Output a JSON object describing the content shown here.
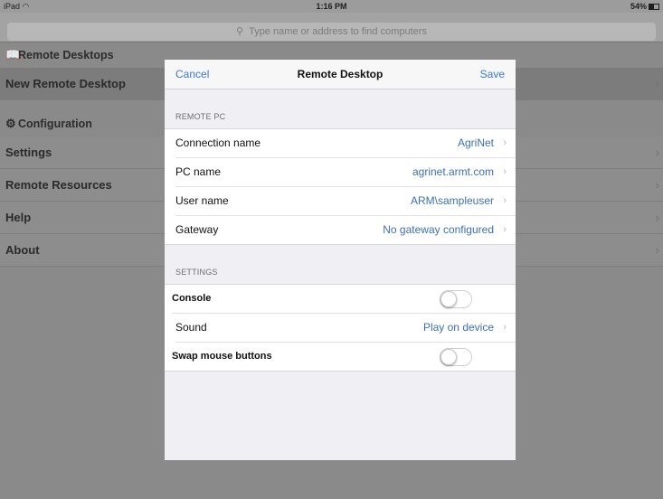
{
  "status_bar": {
    "device": "iPad",
    "time": "1:16 PM",
    "battery": "54%"
  },
  "search": {
    "placeholder": "Type name or address to find computers"
  },
  "sidebar": {
    "sections": [
      {
        "title": "Remote Desktops",
        "icon": "book-icon",
        "items": [
          {
            "label": "New Remote Desktop",
            "selected": true
          }
        ]
      },
      {
        "title": "Configuration",
        "icon": "gear-icon",
        "items": [
          {
            "label": "Settings"
          },
          {
            "label": "Remote Resources"
          },
          {
            "label": "Help"
          },
          {
            "label": "About"
          }
        ]
      }
    ]
  },
  "modal": {
    "cancel_label": "Cancel",
    "title": "Remote Desktop",
    "save_label": "Save",
    "remote_pc": {
      "header": "REMOTE PC",
      "rows": [
        {
          "label": "Connection name",
          "value": "AgriNet"
        },
        {
          "label": "PC name",
          "value": "agrinet.armt.com"
        },
        {
          "label": "User name",
          "value": "ARM\\sampleuser"
        },
        {
          "label": "Gateway",
          "value": "No gateway configured"
        }
      ]
    },
    "settings": {
      "header": "SETTINGS",
      "console_label": "Console",
      "console_on": false,
      "sound_label": "Sound",
      "sound_value": "Play on device",
      "swap_label": "Swap mouse buttons",
      "swap_on": false
    }
  }
}
